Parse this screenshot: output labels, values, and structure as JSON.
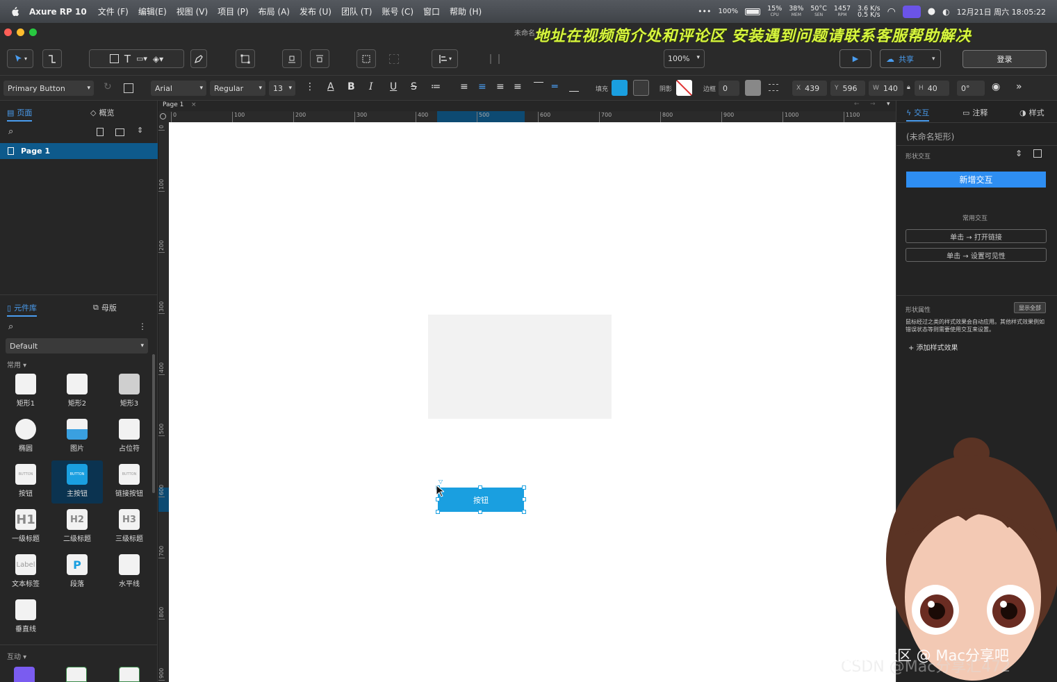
{
  "menubar": {
    "app_name": "Axure RP 10",
    "menus": [
      "文件 (F)",
      "编辑(E)",
      "视图 (V)",
      "项目 (P)",
      "布局 (A)",
      "发布 (U)",
      "团队 (T)",
      "账号 (C)",
      "窗口",
      "帮助 (H)"
    ],
    "more": "•••",
    "battery": "100%",
    "cpu": "15%",
    "cpu_label": "CPU",
    "mem": "38%",
    "mem_label": "MEM",
    "temp": "50°C",
    "temp_label": "SEN",
    "fan": "1457",
    "fan_label": "RPM",
    "net_up": "3.6 K/s",
    "net_down": "0.5 K/s",
    "datetime": "12月21日 周六  18:05:22"
  },
  "titlebar": {
    "doc_title": "未命名",
    "banner": "地址在视频简介处和评论区   安装遇到问题请联系客服帮助解决"
  },
  "toolbar": {
    "zoom": "100%",
    "share": "共享",
    "login": "登录"
  },
  "formatbar": {
    "widget_style": "Primary Button",
    "font": "Arial",
    "weight": "Regular",
    "size": "13",
    "fill_label": "填充",
    "shadow_label": "阴影",
    "border_label": "边框",
    "border_value": "0",
    "x_label": "X",
    "x": "439",
    "y_label": "Y",
    "y": "596",
    "w_label": "W",
    "w": "140",
    "h_label": "H",
    "h": "40",
    "rotation": "0°",
    "fill_color": "#1a9fe0"
  },
  "left_panel": {
    "tab_pages": "页面",
    "tab_outline": "概览",
    "page_item": "Page 1",
    "tab_library": "元件库",
    "tab_masters": "母版",
    "library_select": "Default",
    "section_common": "常用 ▾",
    "section_interactive": "互动 ▾",
    "widgets": [
      {
        "label": "矩形1",
        "icon": ""
      },
      {
        "label": "矩形2",
        "icon": ""
      },
      {
        "label": "矩形3",
        "icon": ""
      },
      {
        "label": "椭圆",
        "icon": ""
      },
      {
        "label": "图片",
        "icon": ""
      },
      {
        "label": "占位符",
        "icon": ""
      },
      {
        "label": "按钮",
        "icon": "BUTTON"
      },
      {
        "label": "主按钮",
        "icon": "BUTTON"
      },
      {
        "label": "链接按钮",
        "icon": "BUTTON"
      },
      {
        "label": "一级标题",
        "icon": "H1"
      },
      {
        "label": "二级标题",
        "icon": "H2"
      },
      {
        "label": "三级标题",
        "icon": "H3"
      },
      {
        "label": "文本标签",
        "icon": "Label"
      },
      {
        "label": "段落",
        "icon": "P"
      },
      {
        "label": "水平线",
        "icon": ""
      },
      {
        "label": "垂直线",
        "icon": ""
      }
    ]
  },
  "canvas": {
    "tab": "Page 1",
    "h_ticks": [
      "0",
      "100",
      "200",
      "300",
      "400",
      "500",
      "600",
      "700",
      "800",
      "900",
      "1000",
      "1100"
    ],
    "v_ticks": [
      "0",
      "100",
      "200",
      "300",
      "400",
      "500",
      "600",
      "700",
      "800",
      "900"
    ],
    "button_label": "按钮"
  },
  "right_panel": {
    "tab_interactions": "交互",
    "tab_notes": "注释",
    "tab_style": "样式",
    "shape_name": "(未命名矩形)",
    "shape_interactions": "形状交互",
    "add_interaction": "新增交互",
    "common_interactions": "常用交互",
    "action_1": "单击 → 打开链接",
    "action_2": "单击 → 设置可见性",
    "shape_props": "形状属性",
    "show_all": "显示全部",
    "desc": "鼠标经过之类的样式效果会自动应用。其他样式效果例如错误状态等则需要使用交互来设置。",
    "add_style": "+ 添加样式效果"
  },
  "watermark": {
    "line1": "掘金技术社区 @ Mac分享吧",
    "line2": "CSDN @Mac分享汇472"
  }
}
